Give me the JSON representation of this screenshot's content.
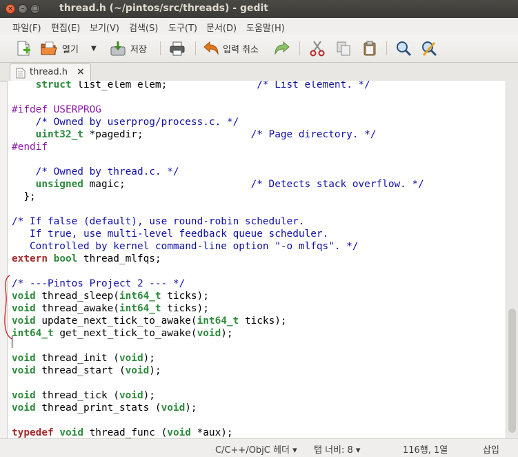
{
  "window": {
    "title": "thread.h (~/pintos/src/threads) - gedit"
  },
  "menu": [
    "파일(F)",
    "편집(E)",
    "보기(V)",
    "검색(S)",
    "도구(T)",
    "문서(D)",
    "도움말(H)"
  ],
  "toolbar": {
    "open_label": "열기",
    "save_label": "저장",
    "undo_label": "입력 취소"
  },
  "tab": {
    "label": "thread.h",
    "close": "×"
  },
  "code_lines": [
    [
      {
        "t": "    "
      },
      {
        "t": "struct",
        "c": "kw"
      },
      {
        "t": " list_elem elem;               "
      },
      {
        "t": "/* List element. */",
        "c": "cm"
      }
    ],
    [],
    [
      {
        "t": "#ifdef USERPROG",
        "c": "pp"
      }
    ],
    [
      {
        "t": "    "
      },
      {
        "t": "/* Owned by userprog/process.c. */",
        "c": "cm"
      }
    ],
    [
      {
        "t": "    "
      },
      {
        "t": "uint32_t",
        "c": "tp"
      },
      {
        "t": " *pagedir;                  "
      },
      {
        "t": "/* Page directory. */",
        "c": "cm"
      }
    ],
    [
      {
        "t": "#endif",
        "c": "pp"
      }
    ],
    [],
    [
      {
        "t": "    "
      },
      {
        "t": "/* Owned by thread.c. */",
        "c": "cm"
      }
    ],
    [
      {
        "t": "    "
      },
      {
        "t": "unsigned",
        "c": "kw"
      },
      {
        "t": " magic;                     "
      },
      {
        "t": "/* Detects stack overflow. */",
        "c": "cm"
      }
    ],
    [
      {
        "t": "  };"
      }
    ],
    [],
    [
      {
        "t": "/* If false (default), use round-robin scheduler.",
        "c": "cm"
      }
    ],
    [
      {
        "t": "   If true, use multi-level feedback queue scheduler.",
        "c": "cm"
      }
    ],
    [
      {
        "t": "   Controlled by kernel command-line option ",
        "c": "cm"
      },
      {
        "t": "\"-o mlfqs\"",
        "c": "cm"
      },
      {
        "t": ". */",
        "c": "cm"
      }
    ],
    [
      {
        "t": "extern",
        "c": "ex"
      },
      {
        "t": " "
      },
      {
        "t": "bool",
        "c": "kw"
      },
      {
        "t": " thread_mlfqs;"
      }
    ],
    [],
    [
      {
        "t": "/* ---Pintos Project 2 --- */",
        "c": "cm"
      }
    ],
    [
      {
        "t": "void",
        "c": "kw"
      },
      {
        "t": " thread_sleep("
      },
      {
        "t": "int64_t",
        "c": "tp"
      },
      {
        "t": " ticks);"
      }
    ],
    [
      {
        "t": "void",
        "c": "kw"
      },
      {
        "t": " thread_awake("
      },
      {
        "t": "int64_t",
        "c": "tp"
      },
      {
        "t": " ticks);"
      }
    ],
    [
      {
        "t": "void",
        "c": "kw"
      },
      {
        "t": " update_next_tick_to_awake("
      },
      {
        "t": "int64_t",
        "c": "tp"
      },
      {
        "t": " ticks);"
      }
    ],
    [
      {
        "t": "int64_t",
        "c": "tp"
      },
      {
        "t": " get_next_tick_to_awake("
      },
      {
        "t": "void",
        "c": "kw"
      },
      {
        "t": ");"
      }
    ],
    [],
    [
      {
        "t": "void",
        "c": "kw"
      },
      {
        "t": " thread_init ("
      },
      {
        "t": "void",
        "c": "kw"
      },
      {
        "t": ");"
      }
    ],
    [
      {
        "t": "void",
        "c": "kw"
      },
      {
        "t": " thread_start ("
      },
      {
        "t": "void",
        "c": "kw"
      },
      {
        "t": ");"
      }
    ],
    [],
    [
      {
        "t": "void",
        "c": "kw"
      },
      {
        "t": " thread_tick ("
      },
      {
        "t": "void",
        "c": "kw"
      },
      {
        "t": ");"
      }
    ],
    [
      {
        "t": "void",
        "c": "kw"
      },
      {
        "t": " thread_print_stats ("
      },
      {
        "t": "void",
        "c": "kw"
      },
      {
        "t": ");"
      }
    ],
    [],
    [
      {
        "t": "typedef",
        "c": "ex"
      },
      {
        "t": " "
      },
      {
        "t": "void",
        "c": "kw"
      },
      {
        "t": " thread_func ("
      },
      {
        "t": "void",
        "c": "kw"
      },
      {
        "t": " *aux);"
      }
    ]
  ],
  "status": {
    "language": "C/C++/ObjC 헤더",
    "tab_width": "탭 너비: 8",
    "position": "116행, 1열",
    "mode": "삽입"
  }
}
